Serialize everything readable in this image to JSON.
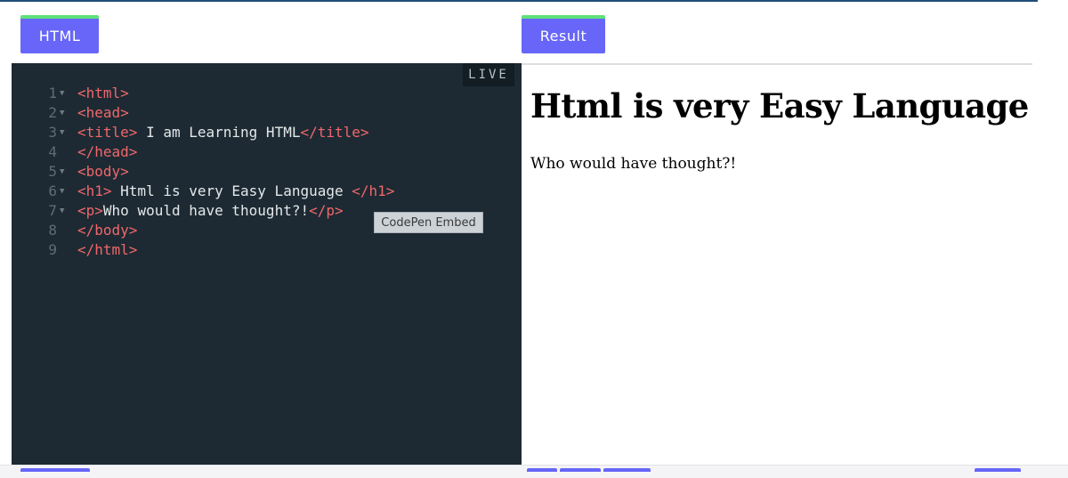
{
  "tabs": {
    "html_label": "HTML",
    "result_label": "Result"
  },
  "editor": {
    "live_label": "LIVE",
    "lines": [
      {
        "num": "1",
        "fold": true,
        "segments": [
          {
            "text": "<html>",
            "cls": "tag"
          }
        ]
      },
      {
        "num": "2",
        "fold": true,
        "segments": [
          {
            "text": "<head>",
            "cls": "tag"
          }
        ]
      },
      {
        "num": "3",
        "fold": true,
        "segments": [
          {
            "text": "<title>",
            "cls": "tag"
          },
          {
            "text": " I am Learning HTML",
            "cls": "plain"
          },
          {
            "text": "</title>",
            "cls": "tag"
          }
        ]
      },
      {
        "num": "4",
        "fold": false,
        "segments": [
          {
            "text": "</head>",
            "cls": "tag"
          }
        ]
      },
      {
        "num": "5",
        "fold": true,
        "segments": [
          {
            "text": "<body>",
            "cls": "tag"
          }
        ]
      },
      {
        "num": "6",
        "fold": true,
        "segments": [
          {
            "text": "<h1>",
            "cls": "tag"
          },
          {
            "text": " Html is very Easy Language ",
            "cls": "plain"
          },
          {
            "text": "</h1>",
            "cls": "tag"
          }
        ]
      },
      {
        "num": "7",
        "fold": true,
        "segments": [
          {
            "text": "<p>",
            "cls": "tag"
          },
          {
            "text": "Who would have thought?!",
            "cls": "plain"
          },
          {
            "text": "</p>",
            "cls": "tag"
          }
        ]
      },
      {
        "num": "8",
        "fold": false,
        "segments": [
          {
            "text": "</body>",
            "cls": "tag"
          }
        ]
      },
      {
        "num": "9",
        "fold": false,
        "segments": [
          {
            "text": "</html>",
            "cls": "tag"
          }
        ]
      }
    ]
  },
  "tooltip": {
    "text": "CodePen Embed"
  },
  "result": {
    "heading": "Html is very Easy Language",
    "paragraph": "Who would have thought?!"
  },
  "colors": {
    "tab_bg": "#6766f8",
    "tab_accent": "#5fe07a",
    "editor_bg": "#1d2a33",
    "tag": "#f0676b",
    "text": "#e4e8ea"
  }
}
